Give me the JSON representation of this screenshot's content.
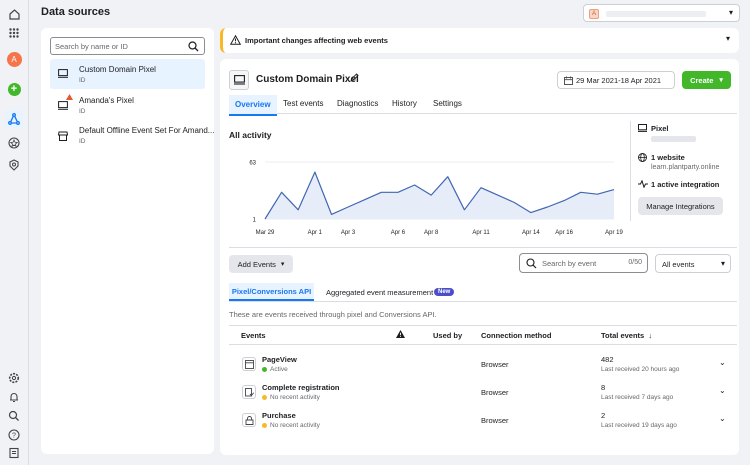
{
  "header": {
    "title": "Data sources",
    "account_initial": "A"
  },
  "left": {
    "search_placeholder": "Search by name or ID",
    "sources": [
      {
        "name": "Custom Domain Pixel",
        "sub": "ID"
      },
      {
        "name": "Amanda's Pixel",
        "sub": "ID"
      },
      {
        "name": "Default Offline Event Set For Amand...",
        "sub": "ID"
      }
    ]
  },
  "rail": {
    "avatar_initial": "A"
  },
  "banner": {
    "text": "Important changes affecting web events"
  },
  "pixel": {
    "title": "Custom Domain Pixel",
    "date_range": "29 Mar 2021-18 Apr 2021",
    "create_label": "Create",
    "tabs": [
      "Overview",
      "Test events",
      "Diagnostics",
      "History",
      "Settings"
    ]
  },
  "activity": {
    "title": "All activity"
  },
  "info": {
    "pixel_label": "Pixel",
    "websites_label": "1 website",
    "website_url": "learn.plantparty.online",
    "integration_label": "1 active integration",
    "manage_button": "Manage Integrations"
  },
  "chart_data": {
    "type": "line",
    "x": [
      "Mar 29",
      "Mar 30",
      "Mar 31",
      "Apr 1",
      "Apr 2",
      "Apr 3",
      "Apr 4",
      "Apr 5",
      "Apr 6",
      "Apr 7",
      "Apr 8",
      "Apr 9",
      "Apr 10",
      "Apr 11",
      "Apr 12",
      "Apr 13",
      "Apr 14",
      "Apr 15",
      "Apr 16",
      "Apr 17",
      "Apr 18",
      "Apr 19"
    ],
    "xticks": [
      "Mar 29",
      "Apr 1",
      "Apr 3",
      "Apr 6",
      "Apr 8",
      "Apr 11",
      "Apr 14",
      "Apr 16",
      "Apr 19"
    ],
    "yticks": [
      1,
      63
    ],
    "ylim": [
      1,
      63
    ],
    "values": [
      1,
      30,
      11,
      52,
      6,
      14,
      22,
      30,
      30,
      38,
      27,
      47,
      11,
      35,
      27,
      19,
      8,
      14,
      21,
      30,
      28,
      33
    ],
    "color": "#4267b2"
  },
  "controls": {
    "add_events": "Add Events",
    "search_placeholder": "Search by event",
    "counter": "0/50",
    "filter": "All events"
  },
  "subtabs": {
    "api": "Pixel/Conversions API",
    "aem": "Aggregated event measurement",
    "new_badge": "New"
  },
  "description": "These are events received through pixel and Conversions API.",
  "table": {
    "headers": {
      "events": "Events",
      "used_by": "Used by",
      "method": "Connection method",
      "total": "Total events"
    },
    "rows": [
      {
        "name": "PageView",
        "status": "Active",
        "status_color": "#42b72a",
        "method": "Browser",
        "total": "482",
        "last": "Last received 20 hours ago"
      },
      {
        "name": "Complete registration",
        "status": "No recent activity",
        "status_color": "#f7b928",
        "method": "Browser",
        "total": "8",
        "last": "Last received 7 days ago"
      },
      {
        "name": "Purchase",
        "status": "No recent activity",
        "status_color": "#f7b928",
        "method": "Browser",
        "total": "2",
        "last": "Last received 19 days ago"
      }
    ]
  }
}
